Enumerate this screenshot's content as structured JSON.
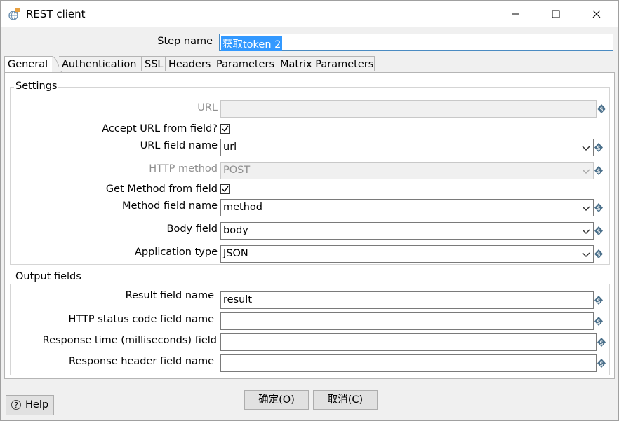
{
  "window": {
    "title": "REST client",
    "icon": "rest-client-globe-icon"
  },
  "step_name": {
    "label": "Step name",
    "value": "获取token 2"
  },
  "tabs": [
    {
      "label": "General",
      "active": true
    },
    {
      "label": "Authentication"
    },
    {
      "label": "SSL"
    },
    {
      "label": "Headers"
    },
    {
      "label": "Parameters"
    },
    {
      "label": "Matrix Parameters"
    }
  ],
  "settings": {
    "title": "Settings",
    "url_label": "URL",
    "url_value": "",
    "accept_url_label": "Accept URL from field?",
    "accept_url_checked": true,
    "url_field_label": "URL field name",
    "url_field_value": "url",
    "http_method_label": "HTTP method",
    "http_method_value": "POST",
    "get_method_label": "Get Method from field",
    "get_method_checked": true,
    "method_field_label": "Method field name",
    "method_field_value": "method",
    "body_field_label": "Body field",
    "body_field_value": "body",
    "app_type_label": "Application type",
    "app_type_value": "JSON"
  },
  "output": {
    "title": "Output fields",
    "result_label": "Result field name",
    "result_value": "result",
    "status_label": "HTTP status code field name",
    "status_value": "",
    "response_time_label": "Response time (milliseconds) field",
    "response_time_value": "",
    "response_header_label": "Response header field name",
    "response_header_value": ""
  },
  "buttons": {
    "ok": "确定(O)",
    "cancel": "取消(C)",
    "help": "Help"
  },
  "colors": {
    "selection": "#3399ff",
    "focus_border": "#4a8bc2",
    "variable_icon": "#4a6f8a"
  }
}
